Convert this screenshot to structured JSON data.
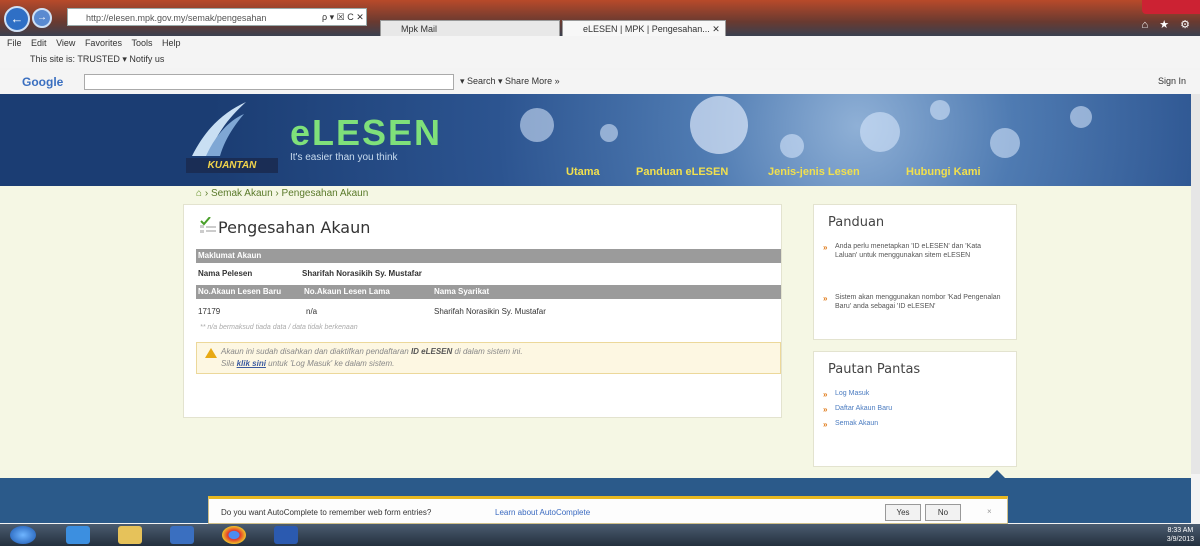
{
  "browser": {
    "address": "http://elesen.mpk.gov.my/semak/pengesahan",
    "address_controls": "ρ ▾ ☒ C ✕",
    "tabs": [
      {
        "label": "Mpk Mail"
      },
      {
        "label": "eLESEN | MPK | Pengesahan... ✕"
      }
    ],
    "right_icons": "⌂ ★ ⚙",
    "menu": [
      "File",
      "Edit",
      "View",
      "Favorites",
      "Tools",
      "Help"
    ],
    "favbar": "This site is: TRUSTED ▾   Notify us",
    "google": {
      "logo": "Google",
      "items": "▾   Search ▾   Share   More »",
      "sign_in": "Sign In"
    }
  },
  "site": {
    "logo": "eLESEN",
    "tagline": "It's easier than you think",
    "badge": "KUANTAN",
    "nav": [
      "Utama",
      "Panduan eLESEN",
      "Jenis-jenis Lesen",
      "Hubungi Kami"
    ],
    "breadcrumb": [
      "Semak Akaun",
      "Pengesahan Akaun"
    ]
  },
  "main": {
    "title": "Pengesahan Akaun",
    "section_header": "Maklumat Akaun",
    "nama_label": "Nama Pelesen",
    "nama_value": "Sharifah Norasikih Sy. Mustafar",
    "columns": [
      "No.Akaun Lesen Baru",
      "No.Akaun Lesen Lama",
      "Nama Syarikat"
    ],
    "row": [
      "17179",
      "n/a",
      "Sharifah Norasikin Sy. Mustafar"
    ],
    "note": "** n/a bermaksud tiada data / data tidak berkenaan",
    "alert_line1_pre": "Akaun ini sudah disahkan dan diaktifkan pendaftaran",
    "alert_bold": "ID eLESEN",
    "alert_line1_post": "di dalam sistem ini.",
    "alert_line2_pre": "Sila",
    "alert_link": "klik sini",
    "alert_line2_post": "untuk 'Log Masuk' ke dalam sistem."
  },
  "panduan": {
    "title": "Panduan",
    "items": [
      "Anda perlu menetapkan 'ID eLESEN' dan 'Kata Laluan' untuk menggunakan sitem eLESEN",
      "Sistem akan menggunakan nombor 'Kad Pengenalan Baru' anda sebagai 'ID eLESEN'"
    ]
  },
  "pautan": {
    "title": "Pautan Pantas",
    "links": [
      "Log Masuk",
      "Daftar Akaun Baru",
      "Semak Akaun"
    ]
  },
  "autocomplete": {
    "message": "Do you want AutoComplete to remember web form entries?",
    "learn": "Learn about AutoComplete",
    "yes": "Yes",
    "no": "No",
    "close": "×"
  },
  "taskbar": {
    "time": "8:33 AM",
    "date": "3/9/2013"
  },
  "colors": {
    "accent_green": "#7fe07a",
    "nav_yellow": "#f1e04e",
    "banner_blue": "#2c5490"
  }
}
